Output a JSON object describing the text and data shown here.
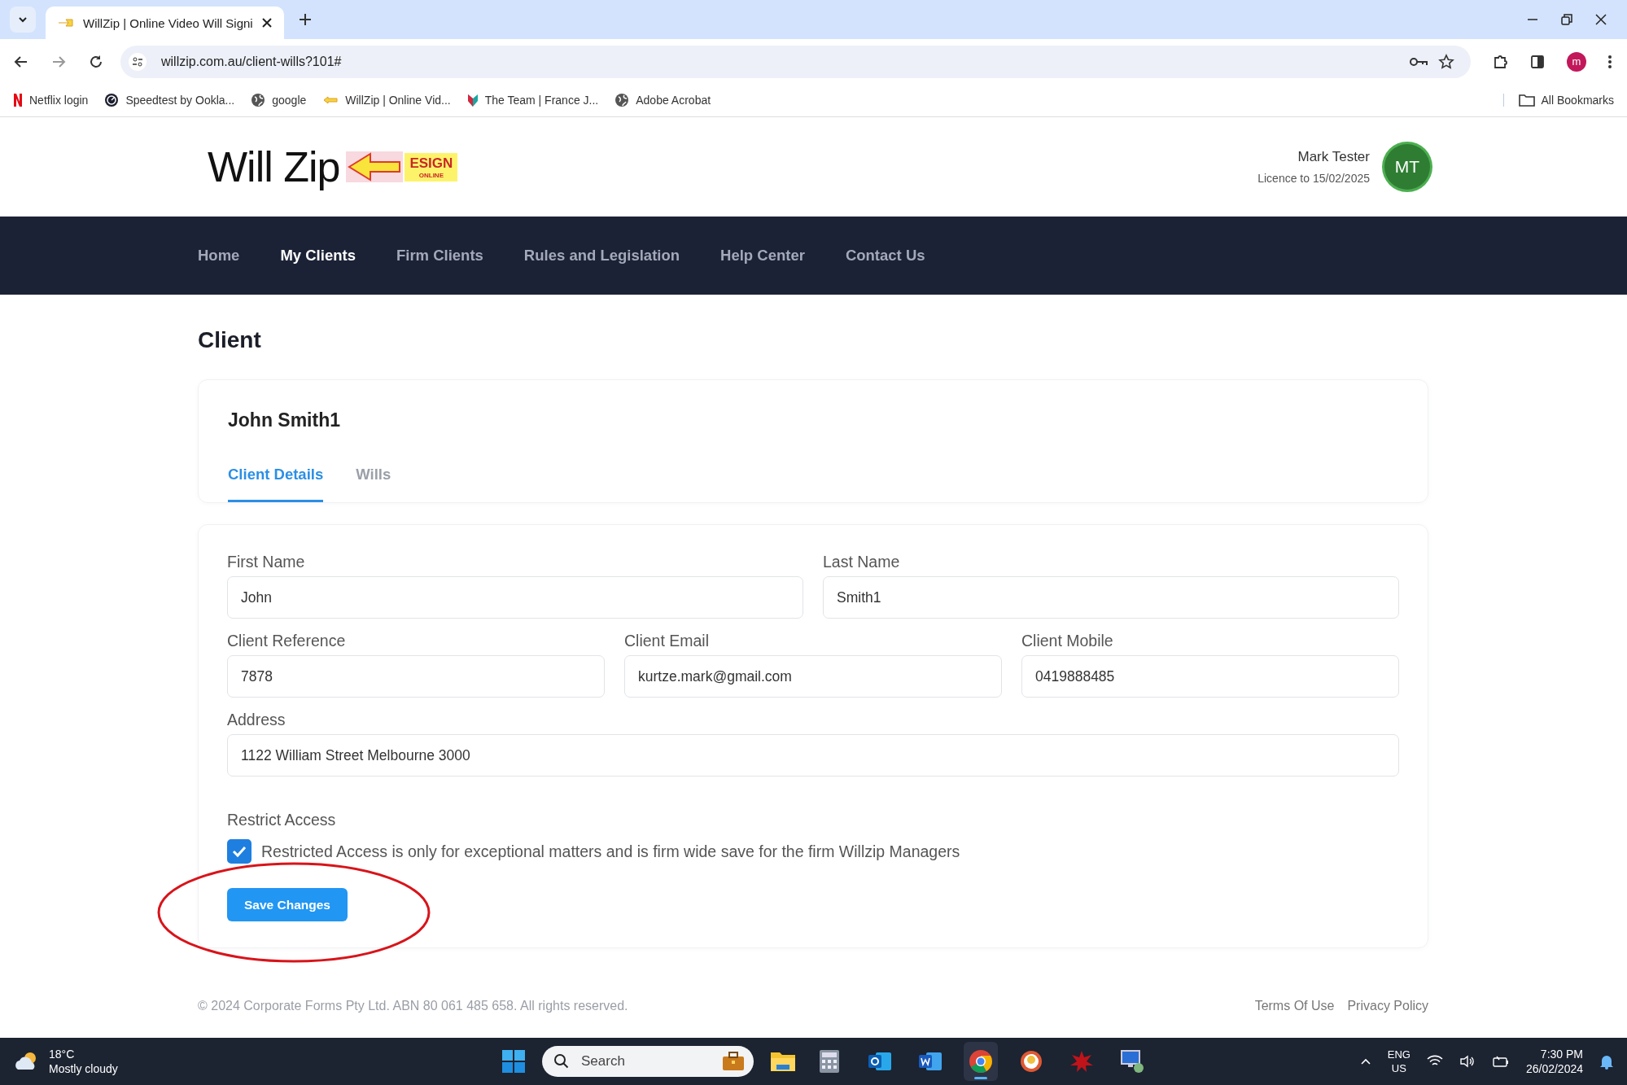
{
  "browser": {
    "tabs": [
      {
        "title": "WillZip | Online Video Will Signi",
        "selected": true
      }
    ],
    "url": "willzip.com.au/client-wills?101#",
    "bookmarks": [
      {
        "kind": "netflix",
        "label": "Netflix login"
      },
      {
        "kind": "speedtest",
        "label": "Speedtest by Ookla..."
      },
      {
        "kind": "globe",
        "label": "google"
      },
      {
        "kind": "willzip",
        "label": "WillZip | Online Vid..."
      },
      {
        "kind": "team",
        "label": "The Team | France J..."
      },
      {
        "kind": "globe",
        "label": "Adobe Acrobat"
      }
    ],
    "all_bookmarks": "All Bookmarks",
    "profile_initial": "m"
  },
  "header": {
    "logo": {
      "text": "Will Zip",
      "badge": "ESIGN",
      "badge_sub": "ONLINE"
    },
    "user": {
      "name": "Mark Tester",
      "licence": "Licence to 15/02/2025",
      "initials": "MT"
    }
  },
  "nav": [
    {
      "label": "Home",
      "selected": false
    },
    {
      "label": "My Clients",
      "selected": true
    },
    {
      "label": "Firm Clients",
      "selected": false
    },
    {
      "label": "Rules and Legislation",
      "selected": false
    },
    {
      "label": "Help Center",
      "selected": false
    },
    {
      "label": "Contact Us",
      "selected": false
    }
  ],
  "page_title": "Client",
  "client": {
    "name": "John Smith1",
    "tabs": [
      {
        "label": "Client Details",
        "selected": true
      },
      {
        "label": "Wills",
        "selected": false
      }
    ]
  },
  "form": {
    "rows": [
      [
        {
          "label": "First Name",
          "value": "John"
        },
        {
          "label": "Last Name",
          "value": "Smith1"
        }
      ],
      [
        {
          "label": "Client Reference",
          "value": "7878"
        },
        {
          "label": "Client Email",
          "value": "kurtze.mark@gmail.com"
        },
        {
          "label": "Client Mobile",
          "value": "0419888485"
        }
      ],
      [
        {
          "label": "Address",
          "value": "1122 William Street Melbourne 3000"
        }
      ]
    ],
    "restrict": {
      "label": "Restrict Access",
      "checked": true,
      "text": "Restricted Access is only for exceptional matters and is firm wide save for the firm Willzip Managers"
    },
    "save_button": "Save Changes"
  },
  "footer": {
    "copyright": "© 2024 Corporate Forms Pty Ltd. ABN 80 061 485 658. All rights reserved.",
    "links": [
      "Terms Of Use",
      "Privacy Policy"
    ]
  },
  "taskbar": {
    "weather": {
      "temp": "18°C",
      "desc": "Mostly cloudy"
    },
    "search": {
      "placeholder": "Search"
    },
    "apps": [
      {
        "kind": "calculator",
        "active": false
      },
      {
        "kind": "outlook",
        "active": false
      },
      {
        "kind": "word",
        "active": false
      },
      {
        "kind": "chrome",
        "active": true
      },
      {
        "kind": "duck",
        "active": false
      },
      {
        "kind": "splat",
        "active": false
      },
      {
        "kind": "remote",
        "active": false
      }
    ],
    "lang": [
      "ENG",
      "US"
    ],
    "time": "7:30 PM",
    "date": "26/02/2024"
  }
}
